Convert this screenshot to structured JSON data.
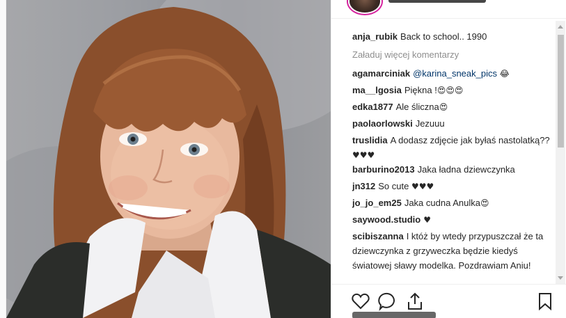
{
  "post": {
    "caption": {
      "user": "anja_rubik",
      "text": "Back to school.. 1990"
    },
    "load_more": "Załaduj więcej komentarzy",
    "comments": [
      {
        "user": "agamarciniak",
        "text": "@karina_sneak_pics",
        "emoji": "😂"
      },
      {
        "user": "ma__lgosia",
        "text": "Piękna !",
        "emoji": "😍😍😍"
      },
      {
        "user": "edka1877",
        "text": "Ale śliczna",
        "emoji": "😍"
      },
      {
        "user": "paolaorlowski",
        "text": "Jezuuu",
        "emoji": ""
      },
      {
        "user": "truslidia",
        "text": "A dodasz zdjęcie jak byłaś nastolatką??",
        "emoji": "♥♥♥"
      },
      {
        "user": "barburino2013",
        "text": "Jaka ładna dziewczynka",
        "emoji": ""
      },
      {
        "user": "jn312",
        "text": "So cute",
        "emoji": "♥♥♥"
      },
      {
        "user": "jo_jo_em25",
        "text": "Jaka cudna Anulka",
        "emoji": "😍"
      },
      {
        "user": "saywood.studio",
        "text": "",
        "emoji": "♥"
      },
      {
        "user": "scibiszanna",
        "text": "I któż by wtedy przypuszczał że ta dziewczynka z grzyweczka będzie kiedyś światowej sławy modelka. Pozdrawiam Aniu!",
        "emoji": ""
      }
    ]
  },
  "icons": {
    "like": "heart-icon",
    "comment": "comment-icon",
    "share": "share-icon",
    "save": "bookmark-icon"
  },
  "colors": {
    "text": "#262626",
    "muted": "#8e8e8e",
    "link": "#003569",
    "story_ring": "#d6249f"
  }
}
